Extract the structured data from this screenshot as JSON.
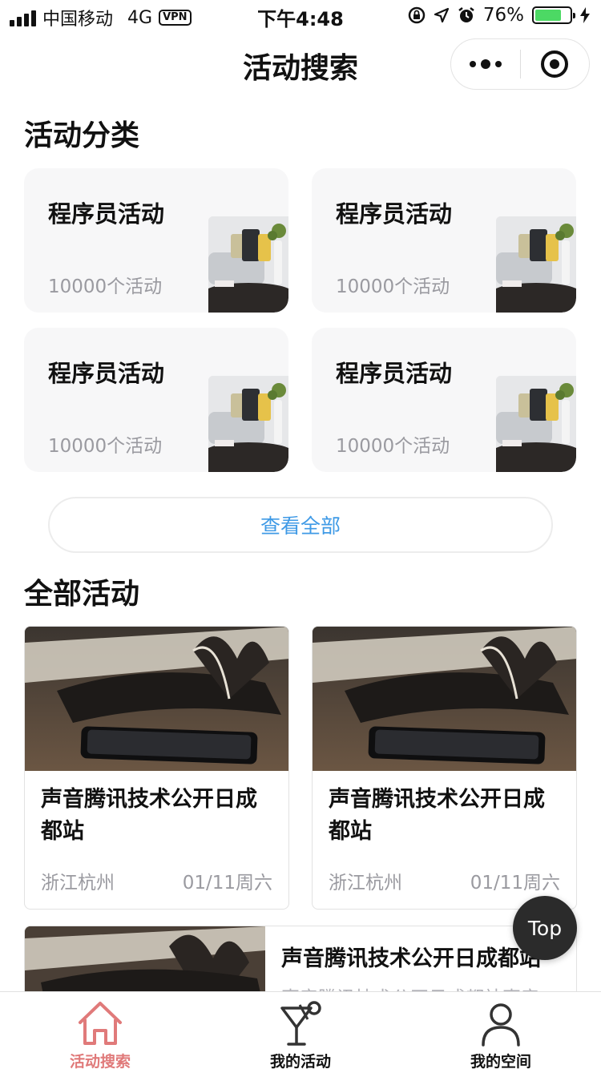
{
  "status_bar": {
    "carrier": "中国移动",
    "network": "4G",
    "vpn": "VPN",
    "time": "下午4:48",
    "battery_percent": "76%",
    "battery_level": 0.76,
    "battery_color": "#4cd964"
  },
  "navbar": {
    "title": "活动搜索"
  },
  "categories": {
    "section_title": "活动分类",
    "items": [
      {
        "name": "程序员活动",
        "count": "10000个活动"
      },
      {
        "name": "程序员活动",
        "count": "10000个活动"
      },
      {
        "name": "程序员活动",
        "count": "10000个活动"
      },
      {
        "name": "程序员活动",
        "count": "10000个活动"
      }
    ],
    "view_all_label": "查看全部"
  },
  "events": {
    "section_title": "全部活动",
    "items": [
      {
        "title": "声音腾讯技术公开日成都站",
        "location": "浙江杭州",
        "date": "01/11周六"
      },
      {
        "title": "声音腾讯技术公开日成都站",
        "location": "浙江杭州",
        "date": "01/11周六"
      }
    ],
    "row_item": {
      "title": "声音腾讯技术公开日成都站",
      "description": "声音腾讯技术公开日成都站声音"
    }
  },
  "top_button": {
    "label": "Top"
  },
  "tabbar": {
    "active_color": "#e07a7a",
    "tabs": [
      {
        "label": "活动搜索",
        "icon": "home-icon",
        "active": true
      },
      {
        "label": "我的活动",
        "icon": "cocktail-icon",
        "active": false
      },
      {
        "label": "我的空间",
        "icon": "user-icon",
        "active": false
      }
    ]
  },
  "colors": {
    "link_blue": "#3f9ae6",
    "muted_text": "#9a9aa0",
    "card_bg": "#f7f7f8"
  }
}
